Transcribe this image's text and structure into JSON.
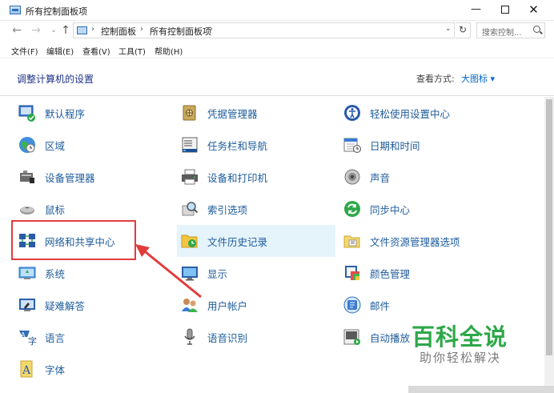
{
  "window": {
    "title": "所有控制面板项",
    "min": "—",
    "max": "",
    "close": "✕"
  },
  "nav": {
    "back": "←",
    "forward": "→",
    "recent": "⌄",
    "up": "↑",
    "breadcrumbs": [
      "控制面板",
      "所有控制面板项"
    ],
    "sep": "›",
    "dropdown": "⌄",
    "refresh": "↻",
    "search_placeholder": "搜索控制..."
  },
  "menu": [
    "文件(F)",
    "编辑(E)",
    "查看(V)",
    "工具(T)",
    "帮助(H)"
  ],
  "header": {
    "title": "调整计算机的设置",
    "view_label": "查看方式:",
    "view_value": "大图标 ▾"
  },
  "items": {
    "col1": [
      "默认程序",
      "区域",
      "设备管理器",
      "鼠标",
      "网络和共享中心",
      "系统",
      "疑难解答",
      "语言",
      "字体"
    ],
    "col2": [
      "凭据管理器",
      "任务栏和导航",
      "设备和打印机",
      "索引选项",
      "文件历史记录",
      "显示",
      "用户帐户",
      "语音识别"
    ],
    "col3": [
      "轻松使用设置中心",
      "日期和时间",
      "声音",
      "同步中心",
      "文件资源管理器选项",
      "颜色管理",
      "邮件",
      "自动播放"
    ]
  },
  "watermark": {
    "title": "百科全说",
    "subtitle": "助你轻松解决"
  },
  "colors": {
    "link": "#1e5c9b",
    "title": "#1e3287",
    "accent": "#0066cc",
    "annotation": "#e33b3b",
    "watermark": "#2ea84a"
  }
}
